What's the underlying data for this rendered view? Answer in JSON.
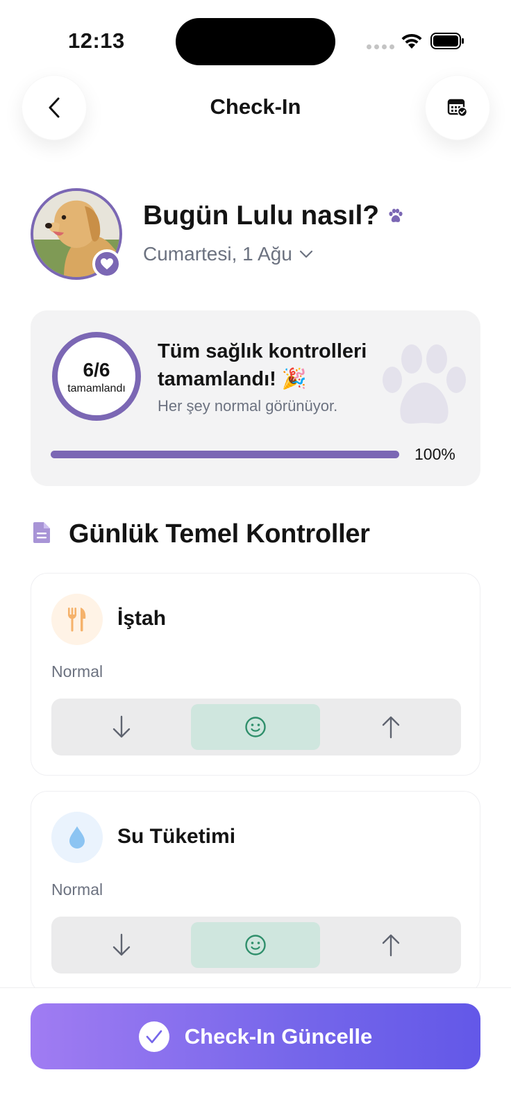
{
  "status_bar": {
    "time": "12:13"
  },
  "nav": {
    "title": "Check-In"
  },
  "pet": {
    "title": "Bugün Lulu nasıl?",
    "date": "Cumartesi, 1 Ağu"
  },
  "summary": {
    "count": "6/6",
    "count_label": "tamamlandı",
    "title": "Tüm sağlık kontrolleri tamamlandı! 🎉",
    "subtitle": "Her şey normal görünüyor.",
    "progress": 1.0,
    "progress_label": "100%"
  },
  "section": {
    "title": "Günlük Temel Kontroller"
  },
  "checks": [
    {
      "name": "İştah",
      "status": "Normal",
      "icon": "fork-knife-icon",
      "selected": "normal"
    },
    {
      "name": "Su Tüketimi",
      "status": "Normal",
      "icon": "water-drop-icon",
      "selected": "normal"
    }
  ],
  "cta": {
    "label": "Check-In Güncelle"
  },
  "colors": {
    "accent": "#7b67b4",
    "selected_segment": "#cfe6de",
    "smile": "#2f8f6b",
    "cta_start": "#a07cf2",
    "cta_end": "#6358e8"
  }
}
